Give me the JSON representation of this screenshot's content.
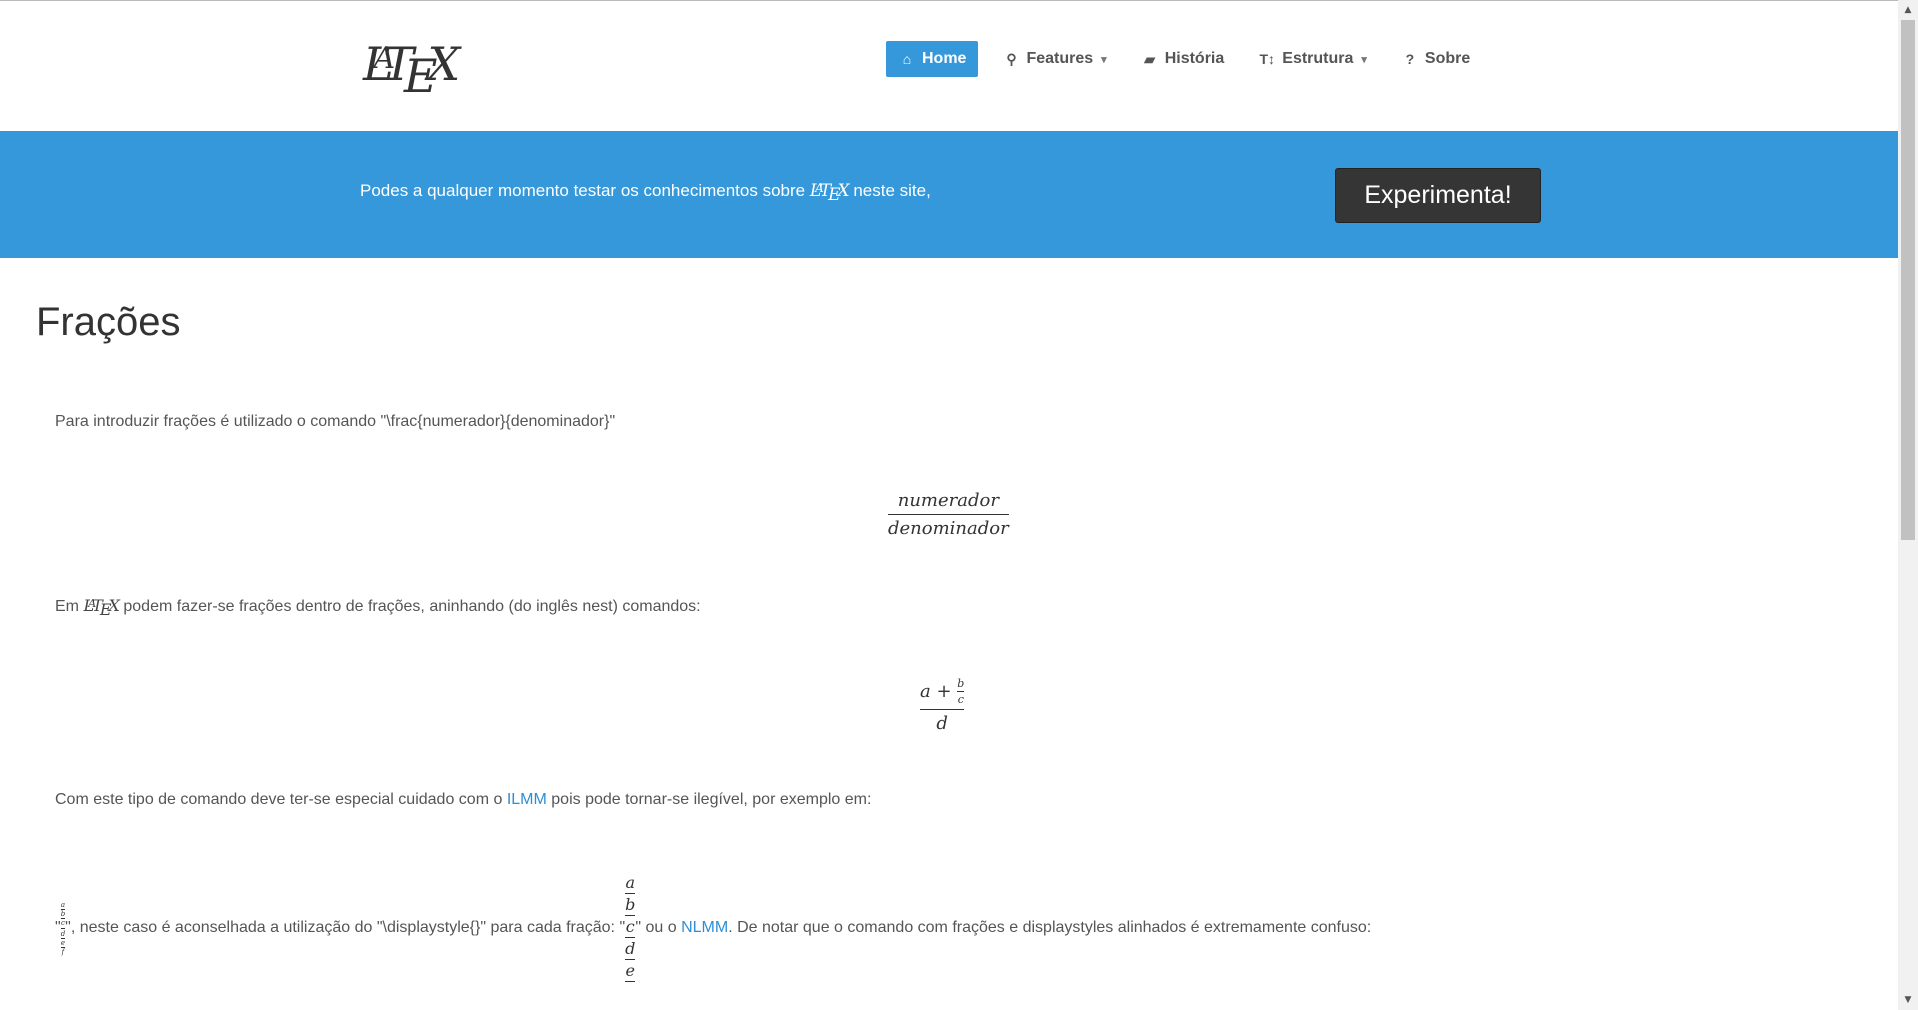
{
  "logo": {
    "text_l": "L",
    "text_a": "A",
    "text_t": "T",
    "text_e": "E",
    "text_x": "X"
  },
  "nav": {
    "items": [
      {
        "label": "Home",
        "icon": "home-icon",
        "active": true
      },
      {
        "label": "Features",
        "icon": "search-icon",
        "dropdown": true
      },
      {
        "label": "História",
        "icon": "book-icon"
      },
      {
        "label": "Estrutura",
        "icon": "text-height-icon",
        "dropdown": true
      },
      {
        "label": "Sobre",
        "icon": "question-circle-icon"
      }
    ]
  },
  "banner": {
    "text_before": "Podes a qualquer momento testar os conhecimentos sobre",
    "text_after": "neste site,",
    "cta_label": "Experimenta!"
  },
  "content": {
    "title": "Frações",
    "p1": "Para introduzir frações é utilizado o comando \"\\frac{numerador}{denominador}\"",
    "eq1": {
      "num": "numerador",
      "den": "denominador"
    },
    "p2_before": "Em",
    "p2_after": "podem fazer-se frações dentro de frações, aninhando (do inglês nest) comandos:",
    "eq2": {
      "num_a": "a",
      "plus": "+",
      "num_b": "b",
      "num_c": "c",
      "den": "d"
    },
    "p3_before": "Com este tipo de comando deve ter-se especial cuidado com o",
    "p3_link": "ILMM",
    "p3_after": "pois pode tornar-se ilegível, por exemplo em:",
    "p4_quote_open": "\"",
    "p4_mid": "\", neste caso é aconselhada a utilização do \"\\displaystyle{}\" para cada fração: \"",
    "p4_after_eq": "\" ou o",
    "p4_link": "NLMM",
    "p4_end": ". De notar que o comando com frações e displaystyles alinhados é extremamente confuso:",
    "nested": {
      "a": "a",
      "b": "b",
      "c": "c",
      "d": "d",
      "e": "e",
      "f": "f"
    }
  },
  "colors": {
    "accent": "#3498db",
    "cta_bg": "#353535",
    "link": "#2d8ed6"
  }
}
